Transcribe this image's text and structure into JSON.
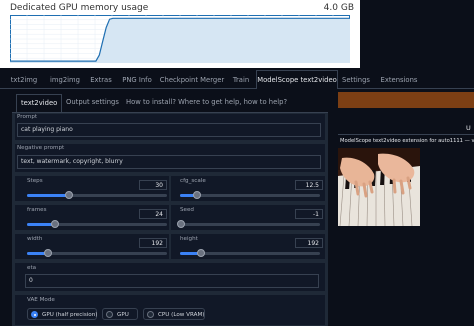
{
  "gpu": {
    "title": "Dedicated GPU memory usage",
    "max_label": "4.0 GB",
    "usage_series": [
      0.02,
      0.02,
      0.02,
      0.02,
      0.02,
      0.02,
      0.02,
      0.02,
      0.02,
      0.02,
      0.02,
      0.02,
      0.02,
      0.02,
      0.02,
      0.02,
      0.02,
      0.02,
      0.02,
      0.02,
      0.02,
      0.02,
      0.02,
      0.02,
      0.02,
      0.02,
      0.15,
      0.45,
      0.75,
      0.93,
      0.95,
      0.95,
      0.95,
      0.95,
      0.95,
      0.95,
      0.95,
      0.95,
      0.95,
      0.95,
      0.95,
      0.95,
      0.95,
      0.95,
      0.95,
      0.95,
      0.95,
      0.95,
      0.95,
      0.95,
      0.95,
      0.95,
      0.95,
      0.95,
      0.95,
      0.95,
      0.95,
      0.95,
      0.95,
      0.95,
      0.95,
      0.95,
      0.95,
      0.95,
      0.95,
      0.95,
      0.95,
      0.95,
      0.95,
      0.95,
      0.95,
      0.95,
      0.95,
      0.95,
      0.95,
      0.95,
      0.95,
      0.95,
      0.95,
      0.95,
      0.95,
      0.95,
      0.95,
      0.95,
      0.95,
      0.95,
      0.95,
      0.95,
      0.95,
      0.95,
      0.95,
      0.95,
      0.95,
      0.95,
      0.95,
      0.95,
      0.95,
      0.95,
      0.95,
      0.95
    ],
    "line_color": "#1f6fb2",
    "fill_color": "#d6e6f3"
  },
  "top_tabs": [
    "txt2img",
    "img2img",
    "Extras",
    "PNG Info",
    "Checkpoint Merger",
    "Train",
    "ModelScope text2video",
    "Settings",
    "Extensions"
  ],
  "active_top_tab": "ModelScope text2video",
  "sub_tabs": [
    "text2video",
    "Output settings",
    "How to install? Where to get help, how to help?"
  ],
  "form": {
    "prompt_label": "Prompt",
    "prompt_value": "cat playing piano",
    "neg_label": "Negative prompt",
    "neg_value": "text, watermark, copyright, blurry",
    "steps": {
      "label": "Steps",
      "value": "30",
      "fraction": 0.3
    },
    "cfg_scale": {
      "label": "cfg_scale",
      "value": "12.5",
      "fraction": 0.12
    },
    "frames": {
      "label": "frames",
      "value": "24",
      "fraction": 0.2
    },
    "seed": {
      "label": "Seed",
      "value": "-1",
      "fraction": 0.01
    },
    "width": {
      "label": "width",
      "value": "192",
      "fraction": 0.15
    },
    "height": {
      "label": "height",
      "value": "192",
      "fraction": 0.15
    },
    "eta": {
      "label": "eta",
      "value": "0"
    },
    "vae_mode_label": "VAE Mode",
    "vae_options": [
      "GPU (half precision)",
      "GPU",
      "CPU (Low VRAM)"
    ],
    "vae_selected": "GPU (half precision)"
  },
  "right": {
    "u_label": "U",
    "caption": "ModelScope text2video extension for auto1111 — ve",
    "accent": "#7c3f14"
  }
}
